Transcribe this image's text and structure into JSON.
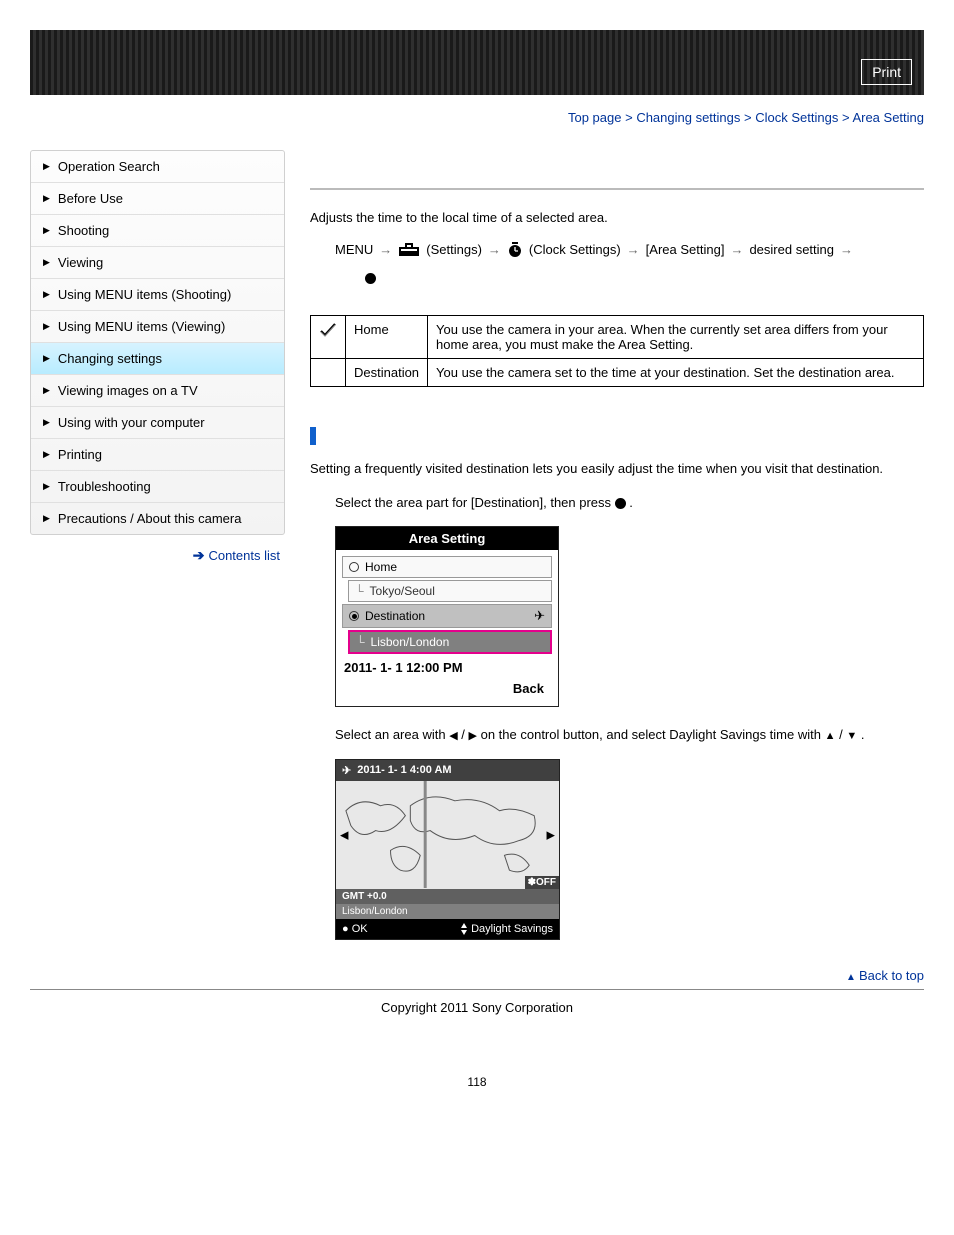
{
  "print_label": "Print",
  "breadcrumb": {
    "top": "Top page",
    "s1": " > ",
    "c1": "Changing settings",
    "c2": "Clock Settings",
    "c3": "Area Setting"
  },
  "sidebar": {
    "items": [
      "Operation Search",
      "Before Use",
      "Shooting",
      "Viewing",
      "Using MENU items (Shooting)",
      "Using MENU items (Viewing)",
      "Changing settings",
      "Viewing images on a TV",
      "Using with your computer",
      "Printing",
      "Troubleshooting",
      "Precautions / About this camera"
    ],
    "contents_link": "Contents list"
  },
  "intro": "Adjusts the time to the local time of a selected area.",
  "path": {
    "menu": "MENU",
    "settings": "(Settings)",
    "clock": "(Clock Settings)",
    "area": "[Area Setting]",
    "desired": "desired setting"
  },
  "table": {
    "home_label": "Home",
    "home_desc": "You use the camera in your area. When the currently set area differs from your home area, you must make the Area Setting.",
    "dest_label": "Destination",
    "dest_desc": "You use the camera set to the time at your destination. Set the destination area."
  },
  "section_text": "Setting a frequently visited destination lets you easily adjust the time when you visit that destination.",
  "step1_prefix": "Select the area part for [Destination], then press ",
  "step1_suffix": ".",
  "step2_p1": "Select an area with ",
  "step2_p2": " / ",
  "step2_p3": " on the control button, and select Daylight Savings time with ",
  "step2_p4": " / ",
  "step2_p5": ".",
  "shot1": {
    "title": "Area Setting",
    "home": "Home",
    "home_city": "Tokyo/Seoul",
    "dest": "Destination",
    "dest_city": "Lisbon/London",
    "date": "2011- 1- 1 12:00 PM",
    "back": "Back"
  },
  "shot2": {
    "date": "2011- 1- 1  4:00 AM",
    "off": "✽OFF",
    "gmt": "GMT +0.0",
    "loc": "Lisbon/London",
    "ok": "OK",
    "ds": "Daylight Savings"
  },
  "back_top": "Back to top",
  "copyright": "Copyright 2011 Sony Corporation",
  "page_num": "118"
}
